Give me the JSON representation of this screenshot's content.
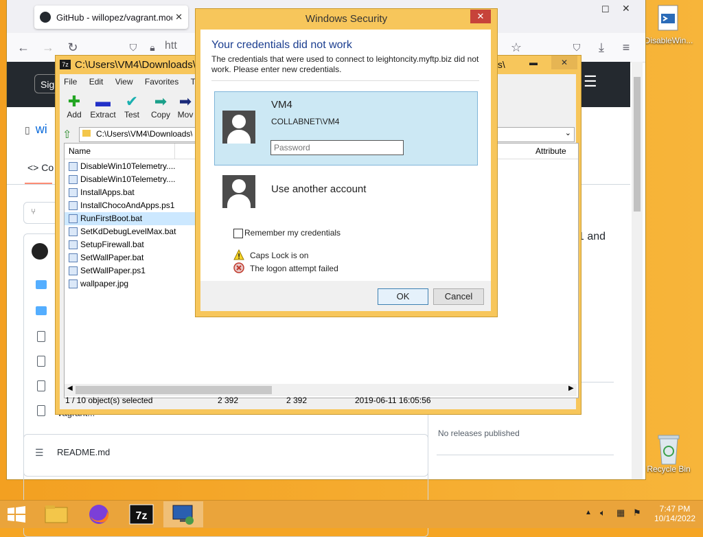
{
  "desktop": {
    "icons": [
      {
        "label": "DisableWin..."
      },
      {
        "label": "Recycle Bin"
      }
    ]
  },
  "browser": {
    "tab_title": "GitHub - willopez/vagrant.mod",
    "url_partial": "htt",
    "header_signin": "Sig",
    "repo_name_partial": "wi",
    "code_tab_partial": "Co",
    "side_text_partial": "1 and",
    "readme_label": "README.md",
    "releases_text": "No releases published",
    "row_partial": "vagrant..."
  },
  "sevenzip": {
    "title": "C:\\Users\\VM4\\Downloads\\",
    "title_right": "ts\\",
    "menu": [
      "File",
      "Edit",
      "View",
      "Favorites",
      "Tool"
    ],
    "tools": [
      {
        "label": "Add",
        "icon": "plus-icon",
        "color": "#22a522"
      },
      {
        "label": "Extract",
        "icon": "minus-icon",
        "color": "#2230c8"
      },
      {
        "label": "Test",
        "icon": "check-icon",
        "color": "#1ab0b0"
      },
      {
        "label": "Copy",
        "icon": "arrow-right-icon",
        "color": "#1aa08a"
      },
      {
        "label": "Mov",
        "icon": "arrow-right-icon",
        "color": "#1a2a7a"
      }
    ],
    "path": "C:\\Users\\VM4\\Downloads\\",
    "col_name": "Name",
    "col_attribute": "Attribute",
    "files": [
      "DisableWin10Telemetry....",
      "DisableWin10Telemetry....",
      "InstallApps.bat",
      "InstallChocoAndApps.ps1",
      "RunFirstBoot.bat",
      "SetKdDebugLevelMax.bat",
      "SetupFirewall.bat",
      "SetWallPaper.bat",
      "SetWallPaper.ps1",
      "wallpaper.jpg"
    ],
    "status": {
      "selected": "1 / 10 object(s) selected",
      "size": "2 392",
      "packed": "2 392",
      "date": "2019-06-11 16:05:56"
    }
  },
  "security": {
    "title": "Windows Security",
    "heading": "Your credentials did not work",
    "message": "The credentials that were used to connect to leightoncity.myftp.biz did not work. Please enter new credentials.",
    "user_name": "VM4",
    "user_domain": "COLLABNET\\VM4",
    "password_placeholder": "Password",
    "other_account": "Use another account",
    "remember": "Remember my credentials",
    "warning_caps": "Caps Lock is on",
    "error_logon": "The logon attempt failed",
    "ok": "OK",
    "cancel": "Cancel",
    "close_glyph": "✕"
  },
  "taskbar": {
    "time": "7:47 PM",
    "date": "10/14/2022"
  }
}
